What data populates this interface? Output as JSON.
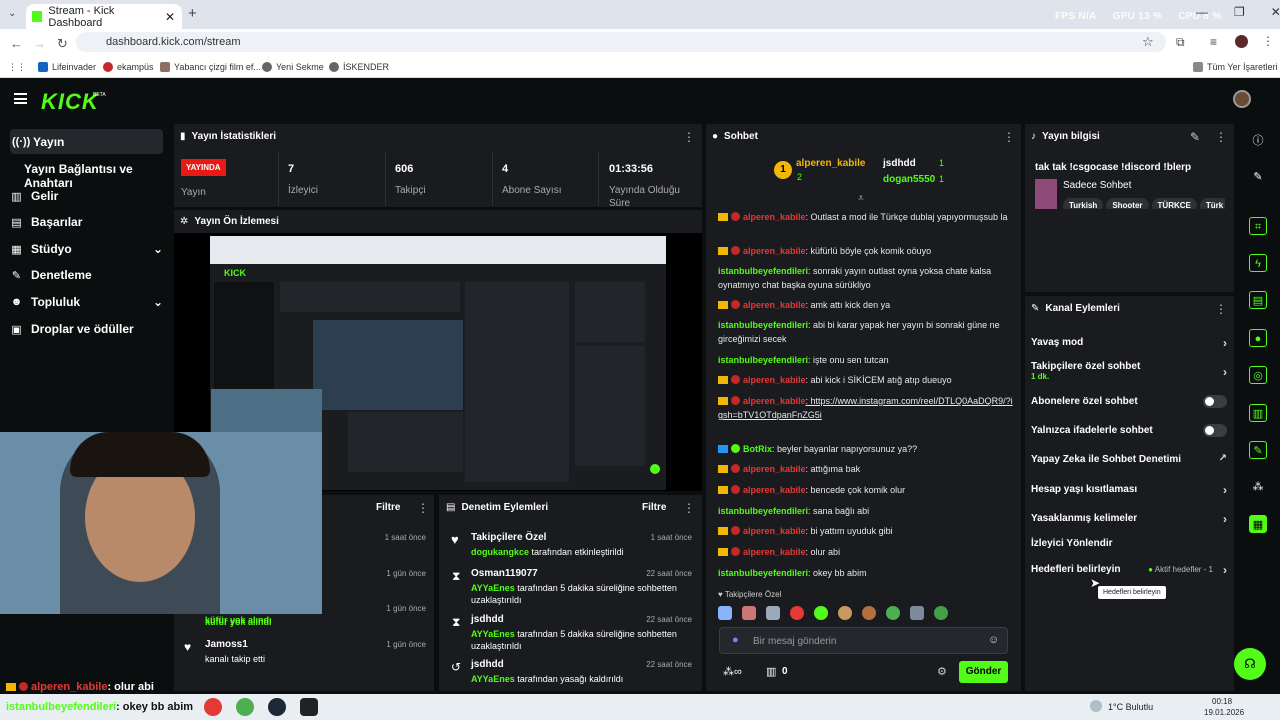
{
  "browser": {
    "tab_title": "Stream - Kick Dashboard",
    "url": "dashboard.kick.com/stream",
    "perf": {
      "fps": "FPS N/A",
      "gpu": "GPU 13 %",
      "cpu": "CPU 8 %"
    },
    "bookmarks": [
      "Lifeinvader",
      "ekampüs",
      "Yabancı çizgi film ef...",
      "Yeni Sekme",
      "İSKENDER"
    ],
    "all_bookmarks": "Tüm Yer İşaretleri"
  },
  "header": {
    "logo": "KICK",
    "beta": "BETA"
  },
  "sidebar": {
    "items": [
      {
        "label": "Yayın",
        "icon": "((·))"
      },
      {
        "label": "Yayın Bağlantısı ve Anahtarı",
        "icon": ""
      },
      {
        "label": "Gelir",
        "icon": "▥"
      },
      {
        "label": "Başarılar",
        "icon": "▤"
      },
      {
        "label": "Stüdyo",
        "icon": "▦"
      },
      {
        "label": "Denetleme",
        "icon": "✎"
      },
      {
        "label": "Topluluk",
        "icon": "☻"
      },
      {
        "label": "Droplar ve ödüller",
        "icon": "▣"
      }
    ]
  },
  "stats": {
    "title": "Yayın İstatistikleri",
    "live_label": "YAYINDA",
    "items": [
      {
        "value": "",
        "label": "Yayın"
      },
      {
        "value": "7",
        "label": "İzleyici"
      },
      {
        "value": "606",
        "label": "Takipçi"
      },
      {
        "value": "4",
        "label": "Abone Sayısı"
      },
      {
        "value": "01:33:56",
        "label": "Yayında Olduğu Süre"
      }
    ]
  },
  "preview": {
    "title": "Yayın Ön İzlemesi"
  },
  "filter_panel": {
    "title": "Filtre",
    "rows": [
      {
        "time": "1 saat önce",
        "name": "",
        "desc": ""
      },
      {
        "time": "1 gün önce",
        "name": "",
        "desc": ""
      },
      {
        "time": "1 gün önce",
        "name": "",
        "desc": "küfür yok alındı"
      },
      {
        "time": "1 gün önce",
        "name": "Jamoss1",
        "desc": "kanalı takip etti"
      }
    ]
  },
  "audit": {
    "title": "Denetim Eylemleri",
    "filter": "Filtre",
    "rows": [
      {
        "name": "Takipçilere Özel",
        "actor": "dogukangkce",
        "desc": "tarafından etkinleştirildi",
        "time": "1 saat önce",
        "icon": "heart-icon"
      },
      {
        "name": "Osman119077",
        "actor": "AYYaEnes",
        "desc": "tarafından 5 dakika süreliğine sohbetten uzaklaştırıldı",
        "time": "22 saat önce",
        "icon": "hourglass-icon"
      },
      {
        "name": "jsdhdd",
        "actor": "AYYaEnes",
        "desc": "tarafından 5 dakika süreliğine sohbetten uzaklaştırıldı",
        "time": "22 saat önce",
        "icon": "hourglass-icon"
      },
      {
        "name": "jsdhdd",
        "actor": "AYYaEnes",
        "desc": "tarafından yasağı kaldırıldı",
        "time": "22 saat önce",
        "icon": "undo-icon"
      }
    ]
  },
  "chat": {
    "title": "Sohbet",
    "leaderboard": [
      {
        "name": "alperen_kabile",
        "count": "2"
      },
      {
        "name": "jsdhdd",
        "count": "1"
      },
      {
        "name": "dogan5550",
        "count": "1"
      }
    ],
    "messages": [
      {
        "user": "alperen_kabile",
        "text": ": Outlast a mod ile Türkçe dublaj yapıyormuşsub la",
        "color": "#e53935",
        "badges": "crown"
      },
      {
        "user": "alperen_kabile",
        "text": ": küfürlü böyle çok komik oöuyo",
        "color": "#e53935",
        "badges": "crown"
      },
      {
        "user": "istanbulbeyefendileri",
        "text": ": sonraki yayın outlast oyna yoksa chate kalsa oynatmıyo chat başka oyuna sürükliyo",
        "color": "#53fc18",
        "badges": ""
      },
      {
        "user": "alperen_kabile",
        "text": ": amk attı kick den ya",
        "color": "#e53935",
        "badges": "crown"
      },
      {
        "user": "istanbulbeyefendileri",
        "text": ": abi bi karar yapak her yayın bi sonraki güne ne girceğimizi secek",
        "color": "#53fc18",
        "badges": ""
      },
      {
        "user": "istanbulbeyefendileri",
        "text": ": işte onu sen tutcan",
        "color": "#53fc18",
        "badges": ""
      },
      {
        "user": "alperen_kabile",
        "text": ": abi kick i SİKİCEM atığ atıp dueuyo",
        "color": "#e53935",
        "badges": "crown"
      },
      {
        "user": "alperen_kabile",
        "text": ": https://www.instagram.com/reel/DTLQ0AaDQR9/?igsh=bTV1OTdpanFnZG5i",
        "color": "#e53935",
        "badges": "crown"
      },
      {
        "user": "BotRix",
        "text": ": beyler bayanlar napıyorsunuz ya??",
        "color": "#53fc18",
        "badges": "bot"
      },
      {
        "user": "alperen_kabile",
        "text": ": attığıma bak",
        "color": "#e53935",
        "badges": "crown"
      },
      {
        "user": "alperen_kabile",
        "text": ": bencede çok komik olur",
        "color": "#e53935",
        "badges": "crown"
      },
      {
        "user": "istanbulbeyefendileri",
        "text": ": sana bağlı abi",
        "color": "#53fc18",
        "badges": ""
      },
      {
        "user": "alperen_kabile",
        "text": ": bi yattım uyuduk gibi",
        "color": "#e53935",
        "badges": "crown"
      },
      {
        "user": "alperen_kabile",
        "text": ": olur abi",
        "color": "#e53935",
        "badges": "crown"
      },
      {
        "user": "istanbulbeyefendileri",
        "text": ": okey bb abim",
        "color": "#53fc18",
        "badges": ""
      }
    ],
    "followers_only": "Takipçilere Özel",
    "input_placeholder": "Bir mesaj gönderin",
    "points": "0",
    "send": "Gönder"
  },
  "stream_info": {
    "title": "Yayın bilgisi",
    "stream_title": "tak tak !csgocase !discord !blerp",
    "category": "Sadece Sohbet",
    "tags": [
      "Turkish",
      "Shooter",
      "TÜRKCE",
      "Türk"
    ]
  },
  "channel_actions": {
    "title": "Kanal Eylemleri",
    "items": [
      {
        "label": "Yavaş mod",
        "control": "chevron"
      },
      {
        "label": "Takipçilere özel sohbet",
        "sub": "1 dk.",
        "control": "chevron"
      },
      {
        "label": "Abonelere özel sohbet",
        "control": "toggle"
      },
      {
        "label": "Yalnızca ifadelerle sohbet",
        "control": "toggle"
      },
      {
        "label": "Yapay Zeka ile Sohbet Denetimi",
        "control": "external"
      },
      {
        "label": "Hesap yaşı kısıtlaması",
        "control": "chevron"
      },
      {
        "label": "Yasaklanmış kelimeler",
        "control": "chevron"
      },
      {
        "label": "İzleyici Yönlendir",
        "control": "none"
      },
      {
        "label": "Hedefleri belirleyin",
        "status": "Aktif hedefler - 1",
        "control": "chevron"
      }
    ],
    "tooltip": "Hedefleri belirleyin"
  },
  "overlay": {
    "user": "alperen_kabile",
    "text": ": olur abi",
    "bottom_user": "istanbulbeyefendileri",
    "bottom_text": ": okey bb abim"
  },
  "taskbar": {
    "weather": "1°C  Bulutlu",
    "time": "00:18",
    "date": "19.01.2026"
  }
}
